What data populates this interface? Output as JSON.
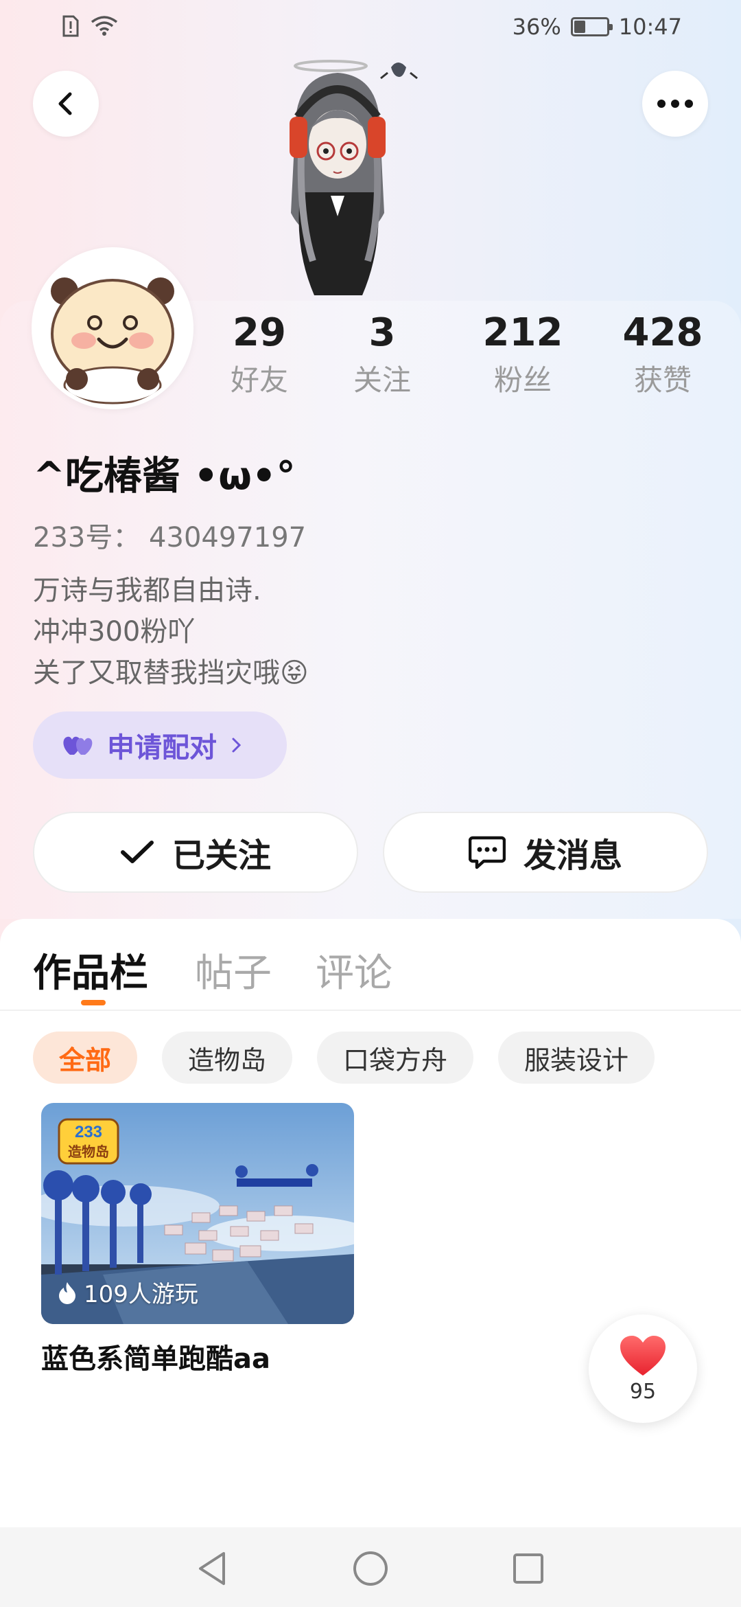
{
  "status_bar": {
    "battery": "36%",
    "battery_level": 0.36,
    "time": "10:47"
  },
  "header": {
    "back_icon": "chevron-left-icon",
    "more_icon": "more-dots-icon"
  },
  "profile": {
    "stats": [
      {
        "value": "29",
        "label": "好友"
      },
      {
        "value": "3",
        "label": "关注"
      },
      {
        "value": "212",
        "label": "粉丝"
      },
      {
        "value": "428",
        "label": "获赞"
      }
    ],
    "nickname": "^吃椿酱 •ω•°",
    "user_id": "233号： 430497197",
    "bio": [
      "万诗与我都自由诗.",
      "冲冲300粉吖",
      "关了又取替我挡灾哦😝"
    ],
    "pair_button": "申请配对",
    "follow_button": "已关注",
    "message_button": "发消息"
  },
  "tabs": [
    {
      "label": "作品栏",
      "active": true
    },
    {
      "label": "帖子",
      "active": false
    },
    {
      "label": "评论",
      "active": false
    }
  ],
  "chips": [
    {
      "label": "全部",
      "active": true
    },
    {
      "label": "造物岛",
      "active": false
    },
    {
      "label": "口袋方舟",
      "active": false
    },
    {
      "label": "服装设计",
      "active": false
    }
  ],
  "works": [
    {
      "title": "蓝色系简单跑酷aa",
      "plays": "109人游玩",
      "badge": "233造物岛"
    }
  ],
  "like_fab": {
    "count": "95"
  },
  "colors": {
    "accent": "#ff7a1a",
    "pair_purple": "#6d55d8",
    "pair_bg": "#e6e0f8"
  }
}
